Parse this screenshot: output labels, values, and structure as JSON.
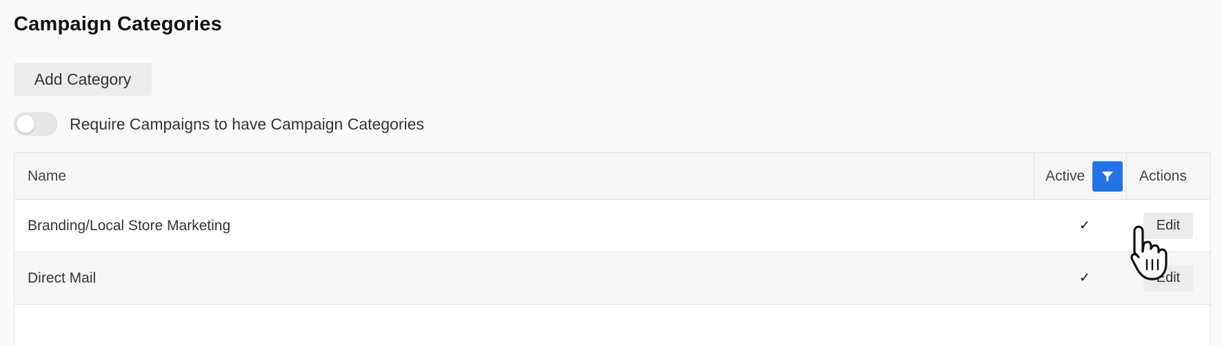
{
  "page": {
    "title": "Campaign Categories"
  },
  "toolbar": {
    "add_label": "Add Category"
  },
  "require_toggle": {
    "label": "Require Campaigns to have Campaign Categories",
    "on": false
  },
  "table": {
    "columns": {
      "name": "Name",
      "active": "Active",
      "actions": "Actions"
    },
    "rows": [
      {
        "name": "Branding/Local Store Marketing",
        "active": "✓",
        "action": "Edit"
      },
      {
        "name": "Direct Mail",
        "active": "✓",
        "action": "Edit"
      }
    ]
  },
  "icons": {
    "filter": "filter-icon",
    "cursor": "hand-pointer-cursor"
  },
  "colors": {
    "accent": "#2472e6",
    "page_background": "#fafafa",
    "row_alt": "#f6f6f6"
  }
}
